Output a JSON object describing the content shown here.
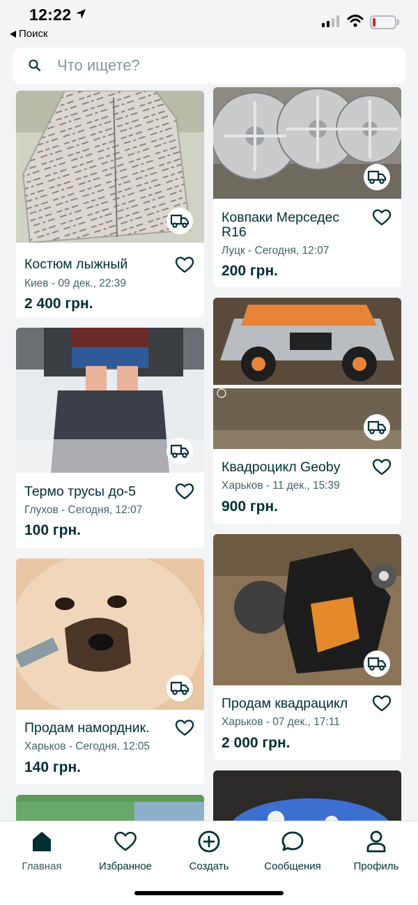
{
  "status_bar": {
    "time": "12:22",
    "back_label": "Поиск"
  },
  "search": {
    "placeholder": "Что ищете?"
  },
  "listings": [
    {
      "title": "Костюм лыжный",
      "location": "Киев - 09 дек., 22:39",
      "price": "2 400 грн.",
      "icon": "delivery-truck-icon"
    },
    {
      "title": "Ковпаки Мерседес R16",
      "location": "Луцк - Сегодня, 12:07",
      "price": "200 грн.",
      "icon": "delivery-truck-icon"
    },
    {
      "title": "Термо трусы до-5",
      "location": "Глухов - Сегодня, 12:07",
      "price": "100 грн.",
      "icon": "delivery-truck-icon"
    },
    {
      "title": "Квадроцикл Geoby",
      "location": "Харьков - 11 дек., 15:39",
      "price": "900 грн.",
      "icon": "delivery-truck-icon"
    },
    {
      "title": "Продам намордник.",
      "location": "Харьков - Сегодня, 12:05",
      "price": "140 грн.",
      "icon": "delivery-truck-icon"
    },
    {
      "title": "Продам квадрацикл",
      "location": "Харьков - 07 дек., 17:11",
      "price": "2 000 грн.",
      "icon": "delivery-truck-icon"
    }
  ],
  "tabs": [
    {
      "label": "Главная",
      "icon": "home-icon",
      "active": true
    },
    {
      "label": "Избранное",
      "icon": "heart-icon",
      "active": false
    },
    {
      "label": "Создать",
      "icon": "plus-circle-icon",
      "active": false
    },
    {
      "label": "Сообщения",
      "icon": "chat-bubble-icon",
      "active": false
    },
    {
      "label": "Профиль",
      "icon": "user-icon",
      "active": false
    }
  ],
  "colors": {
    "background": "#f2f4f5",
    "card": "#ffffff",
    "text_primary": "#002f34",
    "text_secondary": "#406367",
    "battery_low": "#e02020"
  }
}
